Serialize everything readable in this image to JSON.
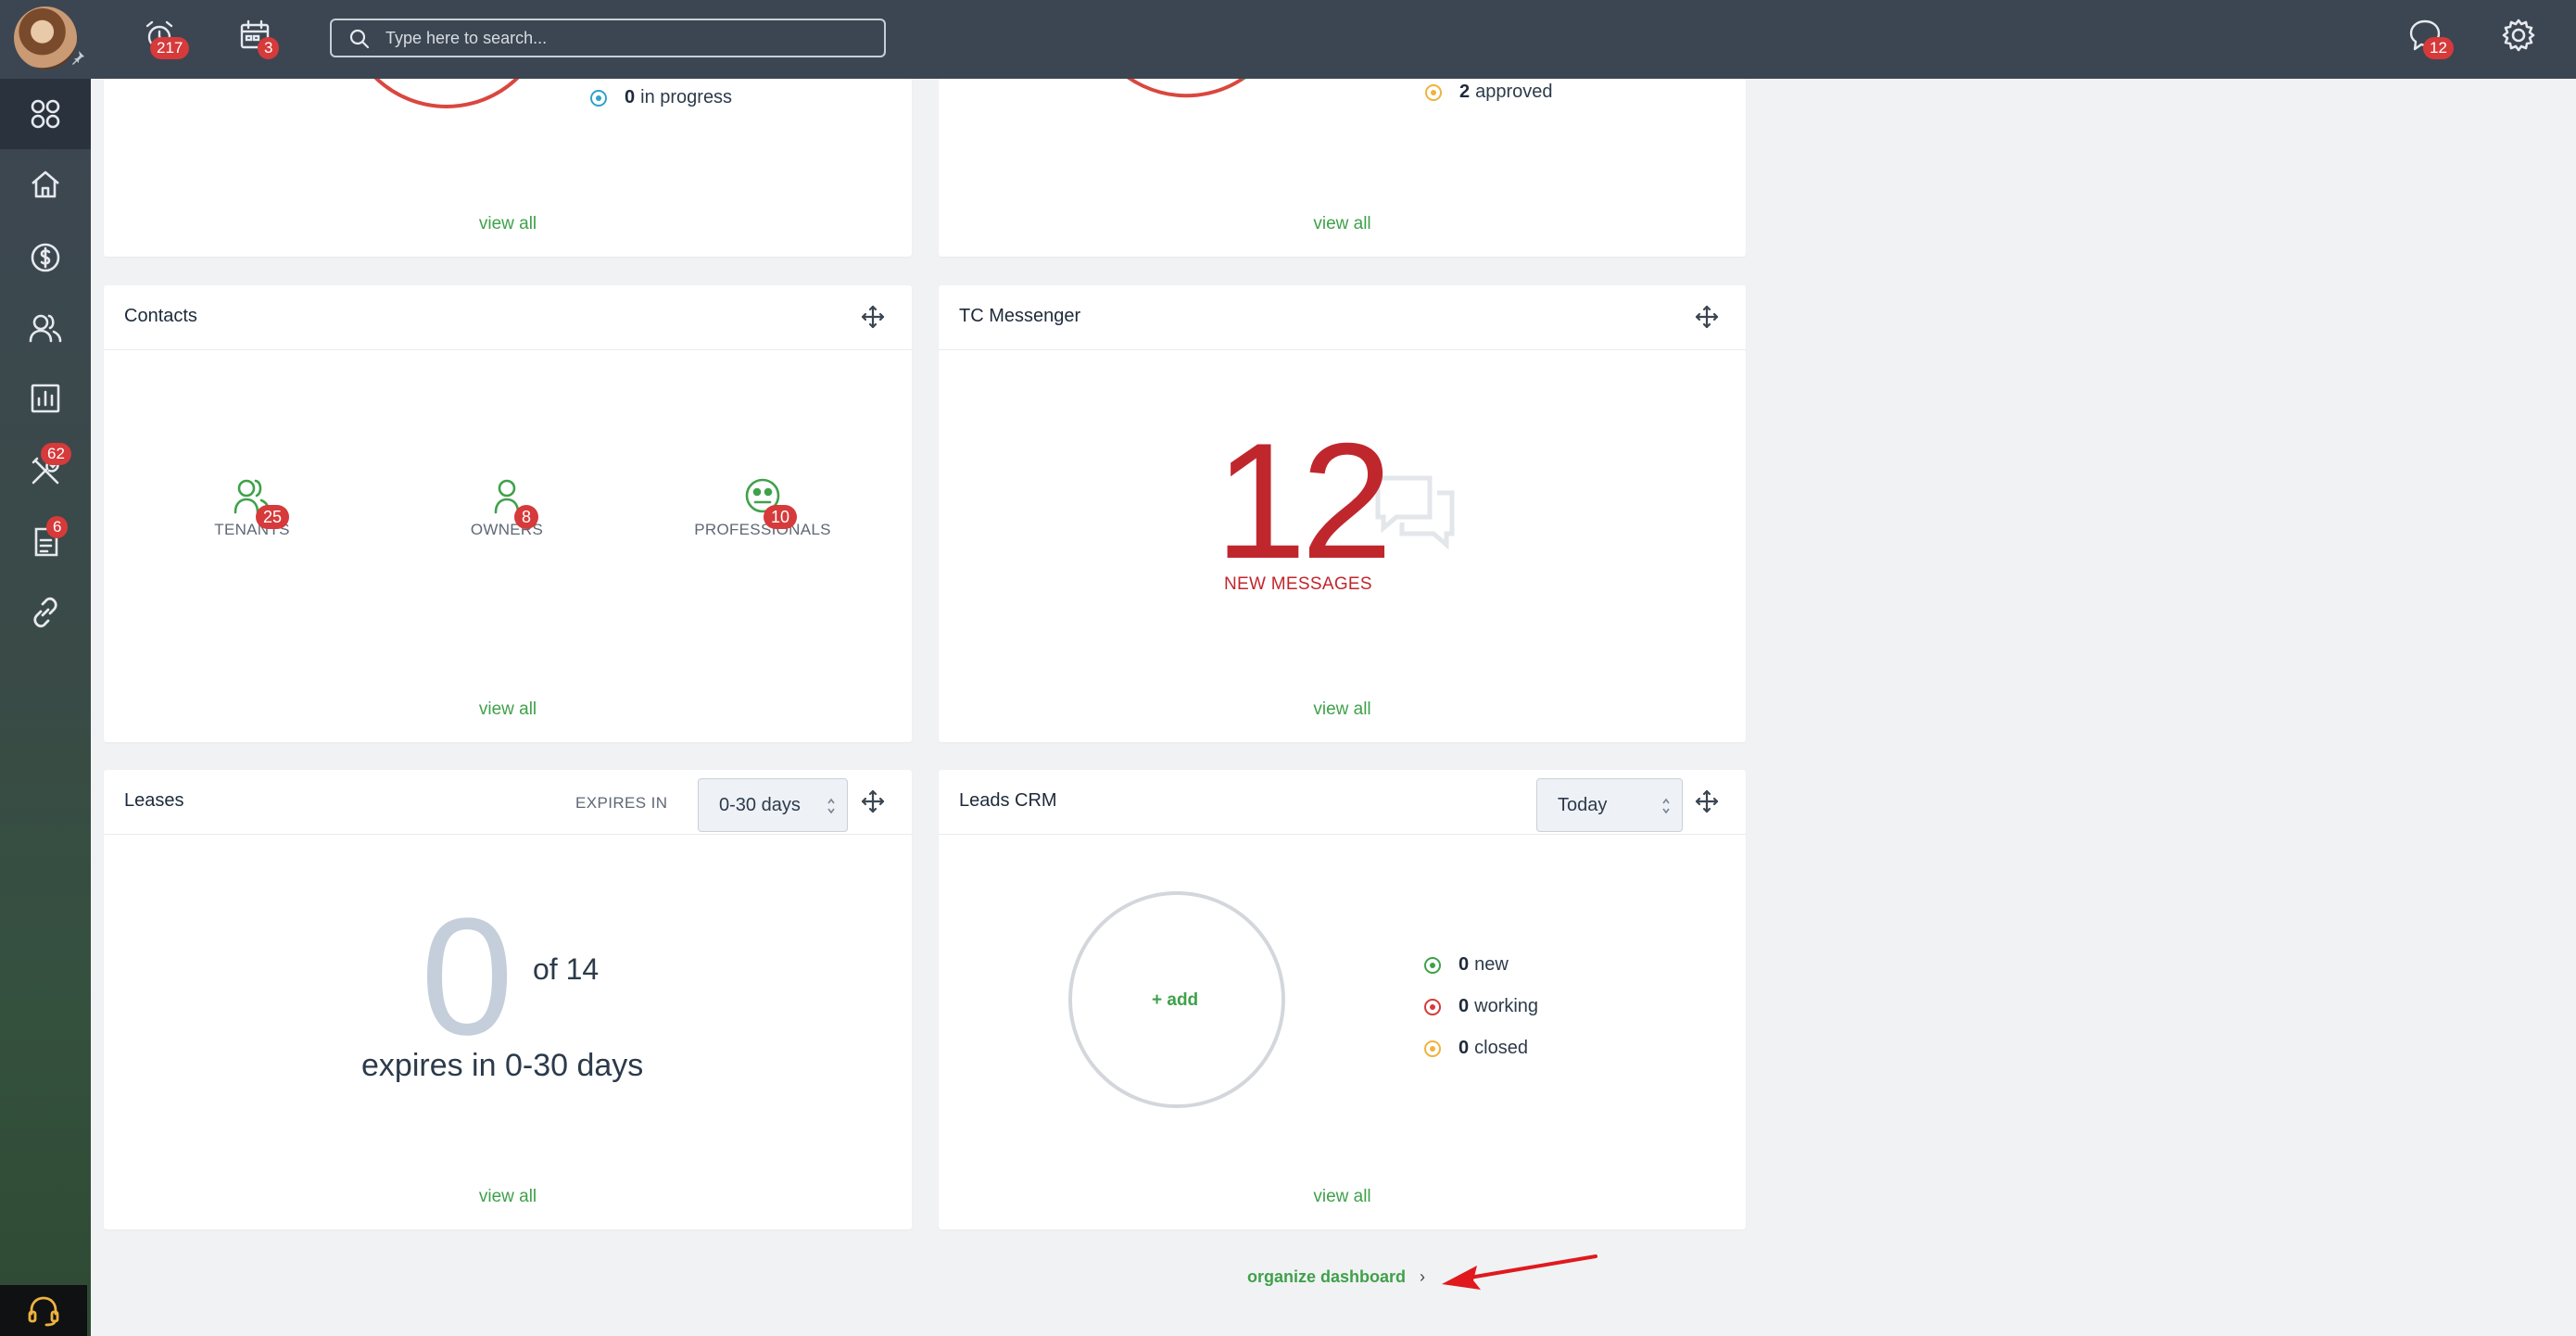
{
  "topbar": {
    "alerts_count": "217",
    "calendar_count": "3",
    "search_placeholder": "Type here to search...",
    "messages_count": "12"
  },
  "sidebar": {
    "items": [
      {
        "icon": "apps-grid-icon",
        "badge": ""
      },
      {
        "icon": "home-icon",
        "badge": ""
      },
      {
        "icon": "dollar-icon",
        "badge": ""
      },
      {
        "icon": "users-icon",
        "badge": ""
      },
      {
        "icon": "chart-icon",
        "badge": ""
      },
      {
        "icon": "tools-icon",
        "badge": "62"
      },
      {
        "icon": "document-icon",
        "badge": "6"
      },
      {
        "icon": "link-icon",
        "badge": ""
      }
    ],
    "help_icon": "headset-icon"
  },
  "top_cards": {
    "left": {
      "stat_value": "0",
      "stat_label": "in progress",
      "view_all": "view all"
    },
    "right": {
      "stat_value": "2",
      "stat_label": "approved",
      "view_all": "view all"
    }
  },
  "contacts": {
    "title": "Contacts",
    "items": [
      {
        "label": "TENANTS",
        "count": "25"
      },
      {
        "label": "OWNERS",
        "count": "8"
      },
      {
        "label": "PROFESSIONALS",
        "count": "10"
      }
    ],
    "view_all": "view all"
  },
  "messenger": {
    "title": "TC Messenger",
    "count": "12",
    "label": "NEW MESSAGES",
    "view_all": "view all"
  },
  "leases": {
    "title": "Leases",
    "expires_label": "EXPIRES IN",
    "select_value": "0-30 days",
    "count": "0",
    "of_text": "of 14",
    "expires_text": "expires in 0-30 days",
    "view_all": "view all"
  },
  "leads": {
    "title": "Leads CRM",
    "select_value": "Today",
    "add_label": "+ add",
    "stats": [
      {
        "value": "0",
        "label": "new",
        "color": "#3fa14a"
      },
      {
        "value": "0",
        "label": "working",
        "color": "#d63a3a"
      },
      {
        "value": "0",
        "label": "closed",
        "color": "#f0b23e"
      }
    ],
    "view_all": "view all"
  },
  "footer": {
    "organize_label": "organize dashboard",
    "chevron": "›"
  },
  "colors": {
    "topbar": "#3c4652",
    "accent_green": "#3fa14a",
    "badge_red": "#d63a3a",
    "big_number_red": "#c0272d"
  }
}
